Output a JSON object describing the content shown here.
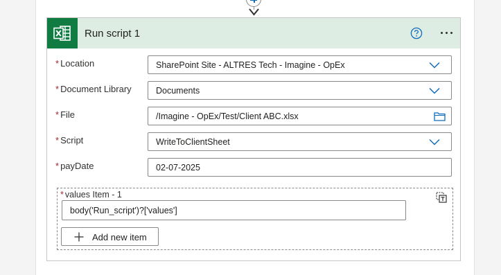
{
  "connector": {
    "add_icon": "plus-icon",
    "arrow_icon": "arrow-down-icon"
  },
  "card": {
    "title": "Run script 1",
    "connector_icon": "excel-icon",
    "help_icon": "help-circle-icon",
    "menu_icon": "more-horizontal-icon",
    "header_color": "#deede3",
    "brand_color": "#107c41"
  },
  "fields": [
    {
      "label": "Location",
      "required": true,
      "value": "SharePoint Site - ALTRES Tech - Imagine -  OpEx",
      "control": "dropdown"
    },
    {
      "label": "Document Library",
      "required": true,
      "value": "Documents",
      "control": "dropdown"
    },
    {
      "label": "File",
      "required": true,
      "value": "/Imagine -  OpEx/Test/Client ABC.xlsx",
      "control": "file-picker"
    },
    {
      "label": "Script",
      "required": true,
      "value": "WriteToClientSheet",
      "control": "dropdown"
    },
    {
      "label": "payDate",
      "required": true,
      "value": "02-07-2025",
      "control": "text"
    }
  ],
  "values_array": {
    "label": "values Item - 1",
    "required": true,
    "item_value": "body('Run_script')?['values']",
    "switch_icon": "switch-to-input-entire-array-icon",
    "add_button_label": "Add new item",
    "add_icon": "plus-icon"
  },
  "required_marker": "*",
  "accent_color": "#0f6cbd",
  "required_color": "#a4262c"
}
